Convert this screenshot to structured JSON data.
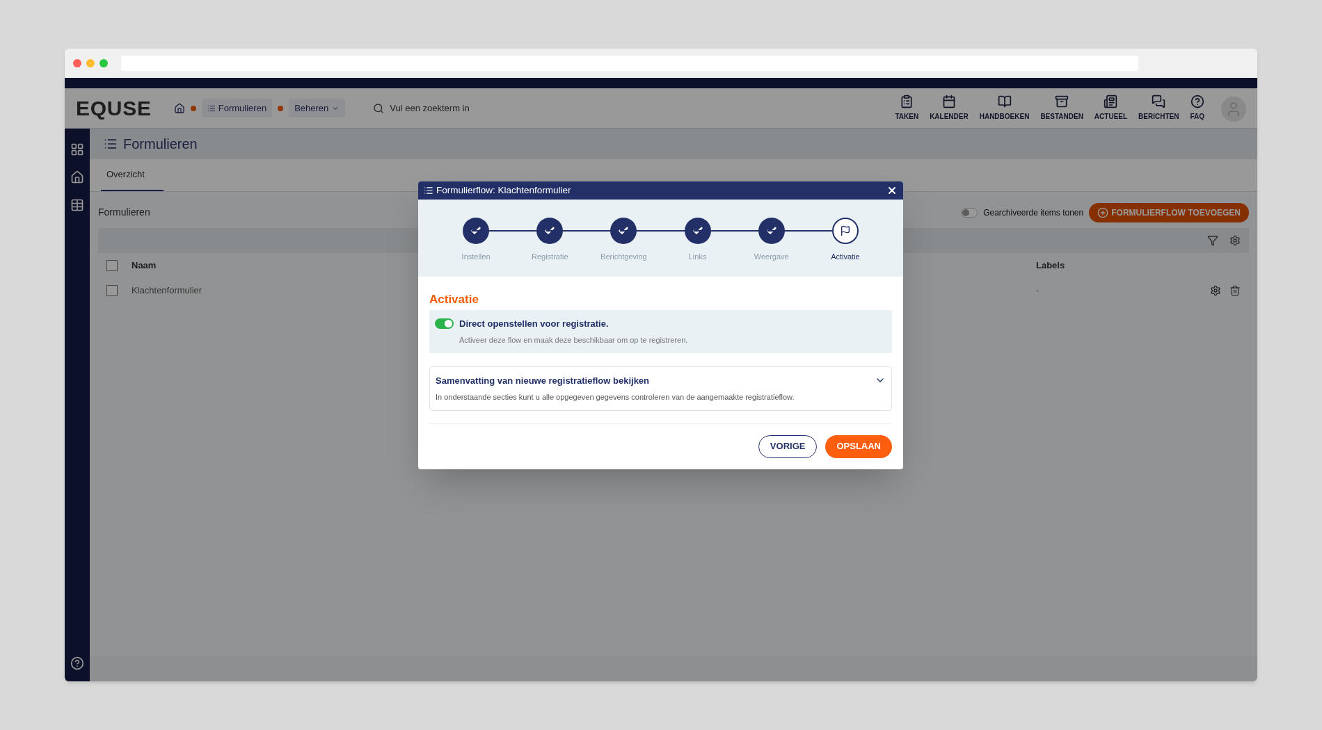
{
  "app": {
    "logo": "EQUSE",
    "breadcrumbs": [
      {
        "label": "Formulieren"
      },
      {
        "label": "Beheren"
      }
    ],
    "search": {
      "placeholder": "Vul een zoekterm in"
    },
    "nav": [
      {
        "label": "TAKEN",
        "kind": "clipboard"
      },
      {
        "label": "KALENDER",
        "kind": "calendar"
      },
      {
        "label": "HANDBOEKEN",
        "kind": "book"
      },
      {
        "label": "BESTANDEN",
        "kind": "archive"
      },
      {
        "label": "ACTUEEL",
        "kind": "news"
      },
      {
        "label": "BERICHTEN",
        "kind": "chat"
      },
      {
        "label": "FAQ",
        "kind": "help"
      }
    ],
    "page_title": "Formulieren",
    "tabs": [
      {
        "label": "Overzicht",
        "selected": true
      }
    ],
    "card": {
      "title": "Formulieren",
      "archived_toggle": {
        "label": "Gearchiveerde items tonen",
        "on": false
      },
      "add_button": "FORMULIERFLOW TOEVOEGEN",
      "select_all": {
        "checked": false
      },
      "columns": [
        "Naam",
        "Labels"
      ],
      "rows": [
        {
          "name": "Klachtenformulier",
          "labels": "-",
          "checked": false
        }
      ]
    }
  },
  "modal": {
    "title": "Formulierflow: Klachtenformulier",
    "steps": [
      {
        "label": "Instellen",
        "completed": true,
        "selected": false
      },
      {
        "label": "Registratie",
        "completed": true,
        "selected": false
      },
      {
        "label": "Berichtgeving",
        "completed": true,
        "selected": false
      },
      {
        "label": "Links",
        "completed": true,
        "selected": false
      },
      {
        "label": "Weergave",
        "completed": true,
        "selected": false
      },
      {
        "label": "Activatie",
        "completed": false,
        "selected": true
      }
    ],
    "section_title": "Activatie",
    "toggle": {
      "label": "Direct openstellen voor registratie.",
      "description": "Activeer deze flow en maak deze beschikbaar om op te registreren.",
      "on": true
    },
    "summary": {
      "title": "Samenvatting van nieuwe registratieflow bekijken",
      "description": "In onderstaande secties kunt u alle opgegeven gegevens controleren van de aangemaakte registratieflow.",
      "expanded": false
    },
    "buttons": [
      {
        "label": "VORIGE",
        "kind": "secondary"
      },
      {
        "label": "OPSLAAN",
        "kind": "primary"
      }
    ]
  }
}
